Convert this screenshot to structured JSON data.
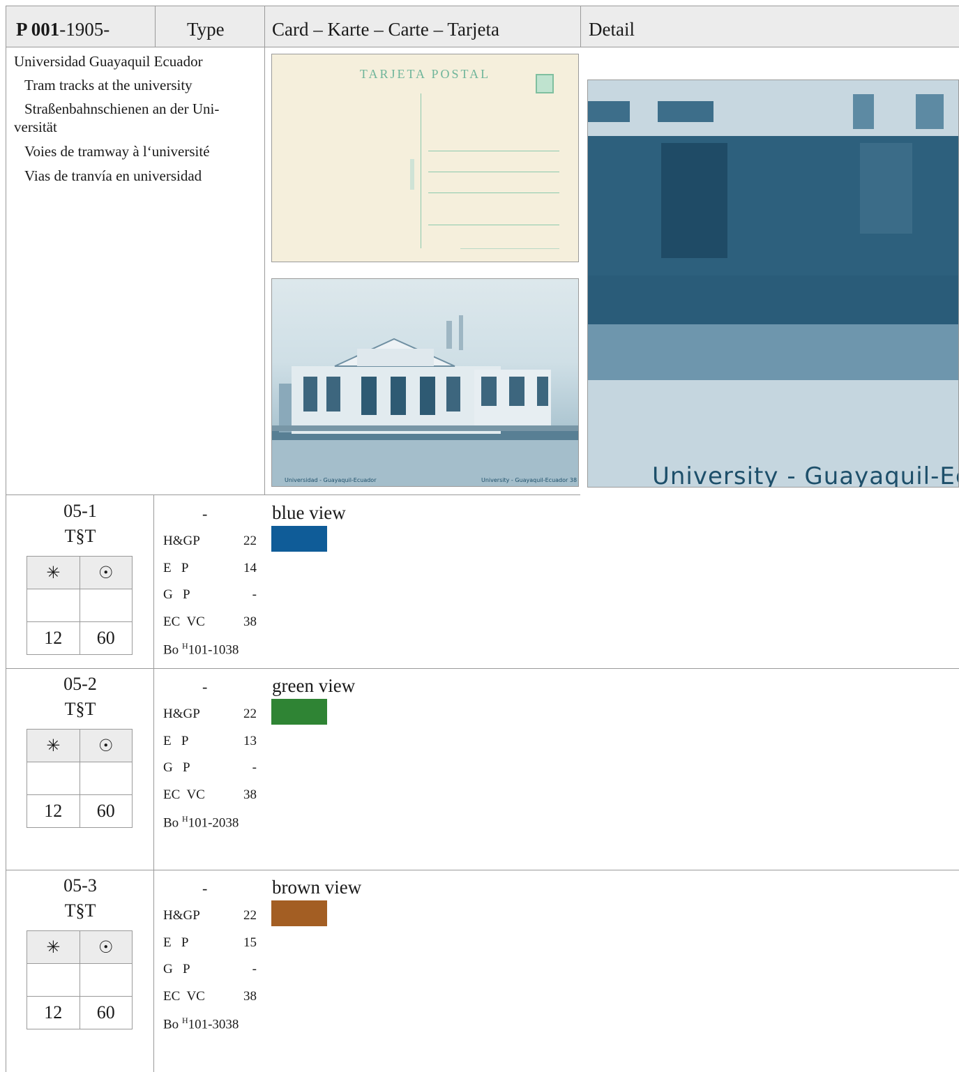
{
  "header": {
    "catalog_bold": "P 001",
    "catalog_year": "-1905-",
    "type_label": "Type",
    "card_label": "Card – Karte – Carte – Tarjeta",
    "detail_label": "Detail"
  },
  "description": {
    "title": "Universidad  Guayaquil Ecuador",
    "en": "Tram tracks at the university",
    "de_1": "Straßenbahnschienen an der Uni-",
    "de_2": "versität",
    "fr": "Voies de tramway à l‘université",
    "es": "Vias de tranvía en universidad"
  },
  "images": {
    "card_back_heading": "TARJETA POSTAL",
    "card_front_caption_left": "Universidad - Guayaquil-Ecuador",
    "card_front_caption_right": "University - Guayaquil-Ecuador 38",
    "detail_caption": "University - Guayaquil-Ecua"
  },
  "symbols": {
    "mint": "✳",
    "used": "☉"
  },
  "variants": [
    {
      "id": "05-1",
      "tst": "T§T",
      "type_dash": "-",
      "mint_value": "12",
      "used_value": "60",
      "hg_label": "H&G",
      "hg_p": "P",
      "hg_val": "22",
      "e_label": "E",
      "e_p": "P",
      "e_val": "14",
      "g_label": "G",
      "g_p": "P",
      "g_val": "-",
      "ec_label": "EC",
      "ec_vc": "VC",
      "ec_val": "38",
      "bo_label": "Bo",
      "bo_sup": "H",
      "bo_val": "101-1038",
      "name": "blue view",
      "color": "#0f5c98"
    },
    {
      "id": "05-2",
      "tst": "T§T",
      "type_dash": "-",
      "mint_value": "12",
      "used_value": "60",
      "hg_label": "H&G",
      "hg_p": "P",
      "hg_val": "22",
      "e_label": "E",
      "e_p": "P",
      "e_val": "13",
      "g_label": "G",
      "g_p": "P",
      "g_val": "-",
      "ec_label": "EC",
      "ec_vc": "VC",
      "ec_val": "38",
      "bo_label": "Bo",
      "bo_sup": "H",
      "bo_val": "101-2038",
      "name": "green view",
      "color": "#2f8434"
    },
    {
      "id": "05-3",
      "tst": "T§T",
      "type_dash": "-",
      "mint_value": "12",
      "used_value": "60",
      "hg_label": "H&G",
      "hg_p": "P",
      "hg_val": "22",
      "e_label": "E",
      "e_p": "P",
      "e_val": "15",
      "g_label": "G",
      "g_p": "P",
      "g_val": "-",
      "ec_label": "EC",
      "ec_vc": "VC",
      "ec_val": "38",
      "bo_label": "Bo",
      "bo_sup": "H",
      "bo_val": "101-3038",
      "name": "brown view",
      "color": "#a35e23"
    }
  ]
}
